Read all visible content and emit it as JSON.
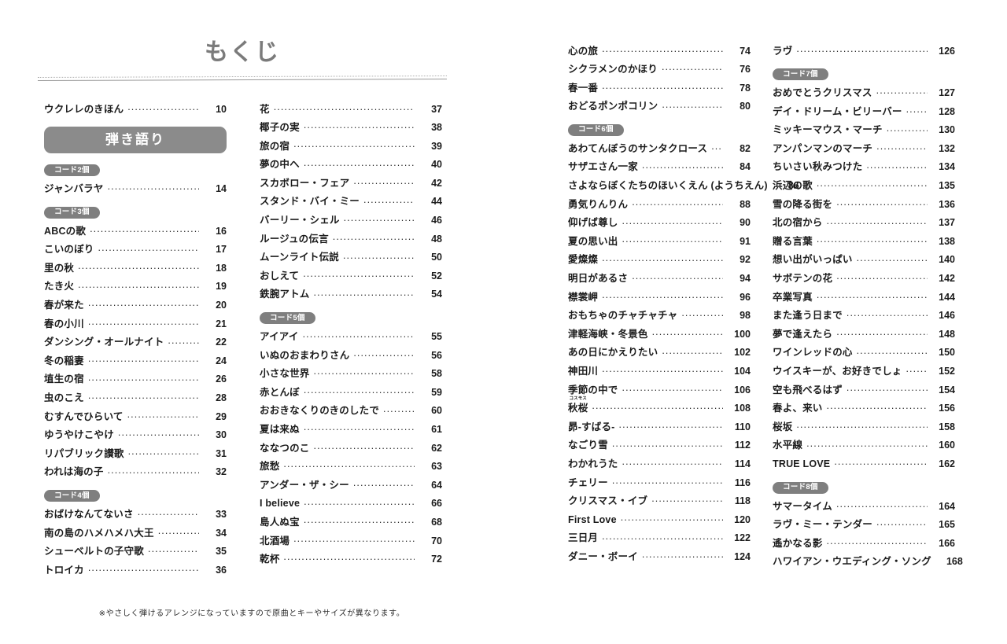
{
  "header": {
    "title": "もくじ"
  },
  "banner": {
    "label": "弾き語り"
  },
  "badges": {
    "chord2": "コード2個",
    "chord3": "コード3個",
    "chord4": "コード4個",
    "chord5": "コード5個",
    "chord6": "コード6個",
    "chord7": "コード7個",
    "chord8": "コード8個"
  },
  "columns": [
    {
      "id": "column-1",
      "blocks": [
        {
          "type": "entries",
          "entries": [
            {
              "title": "ウクレレのきほん",
              "page": "10"
            }
          ]
        },
        {
          "type": "banner",
          "label": "弾き語り"
        },
        {
          "type": "badge",
          "label": "コード2個"
        },
        {
          "type": "entries",
          "entries": [
            {
              "title": "ジャンバラヤ",
              "page": "14"
            }
          ]
        },
        {
          "type": "badge",
          "label": "コード3個"
        },
        {
          "type": "entries",
          "entries": [
            {
              "title": "ABCの歌",
              "page": "16"
            },
            {
              "title": "こいのぼり",
              "page": "17"
            },
            {
              "title": "里の秋",
              "page": "18"
            },
            {
              "title": "たき火",
              "page": "19"
            },
            {
              "title": "春が来た",
              "page": "20"
            },
            {
              "title": "春の小川",
              "page": "21"
            },
            {
              "title": "ダンシング・オールナイト",
              "page": "22"
            },
            {
              "title": "冬の稲妻",
              "page": "24"
            },
            {
              "title": "埴生の宿",
              "page": "26"
            },
            {
              "title": "虫のこえ",
              "page": "28"
            },
            {
              "title": "むすんでひらいて",
              "page": "29"
            },
            {
              "title": "ゆうやけこやけ",
              "page": "30"
            },
            {
              "title": "リパブリック讃歌",
              "page": "31"
            },
            {
              "title": "われは海の子",
              "page": "32"
            }
          ]
        },
        {
          "type": "badge",
          "label": "コード4個"
        },
        {
          "type": "entries",
          "entries": [
            {
              "title": "おばけなんてないさ",
              "page": "33"
            },
            {
              "title": "南の島のハメハメハ大王",
              "page": "34"
            },
            {
              "title": "シューベルトの子守歌",
              "page": "35"
            },
            {
              "title": "トロイカ",
              "page": "36"
            }
          ]
        }
      ]
    },
    {
      "id": "column-2",
      "blocks": [
        {
          "type": "entries",
          "entries": [
            {
              "title": "花",
              "page": "37"
            },
            {
              "title": "椰子の実",
              "page": "38"
            },
            {
              "title": "旅の宿",
              "page": "39"
            },
            {
              "title": "夢の中へ",
              "page": "40"
            },
            {
              "title": "スカボロー・フェア",
              "page": "42"
            },
            {
              "title": "スタンド・バイ・ミー",
              "page": "44"
            },
            {
              "title": "バーリー・シェル",
              "page": "46"
            },
            {
              "title": "ルージュの伝言",
              "page": "48"
            },
            {
              "title": "ムーンライト伝説",
              "page": "50"
            },
            {
              "title": "おしえて",
              "page": "52"
            },
            {
              "title": "鉄腕アトム",
              "page": "54"
            }
          ]
        },
        {
          "type": "badge",
          "label": "コード5個"
        },
        {
          "type": "entries",
          "entries": [
            {
              "title": "アイアイ",
              "page": "55"
            },
            {
              "title": "いぬのおまわりさん",
              "page": "56"
            },
            {
              "title": "小さな世界",
              "page": "58"
            },
            {
              "title": "赤とんぼ",
              "page": "59"
            },
            {
              "title": "おおきなくりのきのしたで",
              "page": "60"
            },
            {
              "title": "夏は来ぬ",
              "page": "61"
            },
            {
              "title": "ななつのこ",
              "page": "62"
            },
            {
              "title": "旅愁",
              "page": "63"
            },
            {
              "title": "アンダー・ザ・シー",
              "page": "64"
            },
            {
              "title": "I believe",
              "page": "66"
            },
            {
              "title": "島人ぬ宝",
              "page": "68"
            },
            {
              "title": "北酒場",
              "page": "70"
            },
            {
              "title": "乾杯",
              "page": "72"
            }
          ]
        }
      ]
    },
    {
      "id": "column-3",
      "blocks": [
        {
          "type": "entries",
          "entries": [
            {
              "title": "心の旅",
              "page": "74"
            },
            {
              "title": "シクラメンのかほり",
              "page": "76"
            },
            {
              "title": "春一番",
              "page": "78"
            },
            {
              "title": "おどるポンポコリン",
              "page": "80"
            }
          ]
        },
        {
          "type": "badge",
          "label": "コード6個"
        },
        {
          "type": "entries",
          "entries": [
            {
              "title": "あわてんぼうのサンタクロース",
              "page": "82"
            },
            {
              "title": "サザエさん一家",
              "page": "84"
            },
            {
              "title": "さよならぼくたちのほいくえん (ようちえん)",
              "page": "86"
            },
            {
              "title": "勇気りんりん",
              "page": "88"
            },
            {
              "title": "仰げば尊し",
              "page": "90"
            },
            {
              "title": "夏の思い出",
              "page": "91"
            },
            {
              "title": "愛燦燦",
              "page": "92"
            },
            {
              "title": "明日があるさ",
              "page": "94"
            },
            {
              "title": "襟裳岬",
              "page": "96"
            },
            {
              "title": "おもちゃのチャチャチャ",
              "page": "98"
            },
            {
              "title": "津軽海峡・冬景色",
              "page": "100"
            },
            {
              "title": "あの日にかえりたい",
              "page": "102"
            },
            {
              "title": "神田川",
              "page": "104"
            },
            {
              "title": "季節の中で",
              "page": "106"
            },
            {
              "title": "秋桜",
              "ruby": "コスモス",
              "page": "108"
            },
            {
              "title": "昴-すばる-",
              "page": "110"
            },
            {
              "title": "なごり雪",
              "page": "112"
            },
            {
              "title": "わかれうた",
              "page": "114"
            },
            {
              "title": "チェリー",
              "page": "116"
            },
            {
              "title": "クリスマス・イブ",
              "page": "118"
            },
            {
              "title": "First Love",
              "page": "120"
            },
            {
              "title": "三日月",
              "page": "122"
            },
            {
              "title": "ダニー・ボーイ",
              "page": "124"
            }
          ]
        }
      ]
    },
    {
      "id": "column-4",
      "blocks": [
        {
          "type": "entries",
          "entries": [
            {
              "title": "ラヴ",
              "page": "126"
            }
          ]
        },
        {
          "type": "badge",
          "label": "コード7個"
        },
        {
          "type": "entries",
          "entries": [
            {
              "title": "おめでとうクリスマス",
              "page": "127"
            },
            {
              "title": "デイ・ドリーム・ビリーバー",
              "page": "128"
            },
            {
              "title": "ミッキーマウス・マーチ",
              "page": "130"
            },
            {
              "title": "アンパンマンのマーチ",
              "page": "132"
            },
            {
              "title": "ちいさい秋みつけた",
              "page": "134"
            },
            {
              "title": "浜辺の歌",
              "page": "135"
            },
            {
              "title": "雪の降る街を",
              "page": "136"
            },
            {
              "title": "北の宿から",
              "page": "137"
            },
            {
              "title": "贈る言葉",
              "page": "138"
            },
            {
              "title": "想い出がいっぱい",
              "page": "140"
            },
            {
              "title": "サボテンの花",
              "page": "142"
            },
            {
              "title": "卒業写真",
              "page": "144"
            },
            {
              "title": "また逢う日まで",
              "page": "146"
            },
            {
              "title": "夢で逢えたら",
              "page": "148"
            },
            {
              "title": "ワインレッドの心",
              "page": "150"
            },
            {
              "title": "ウイスキーが、お好きでしょ",
              "page": "152"
            },
            {
              "title": "空も飛べるはず",
              "page": "154"
            },
            {
              "title": "春よ、来い",
              "page": "156"
            },
            {
              "title": "桜坂",
              "page": "158"
            },
            {
              "title": "水平線",
              "page": "160"
            },
            {
              "title": "TRUE LOVE",
              "page": "162"
            }
          ]
        },
        {
          "type": "badge",
          "label": "コード8個"
        },
        {
          "type": "entries",
          "entries": [
            {
              "title": "サマータイム",
              "page": "164"
            },
            {
              "title": "ラヴ・ミー・テンダー",
              "page": "165"
            },
            {
              "title": "遙かなる影",
              "page": "166"
            },
            {
              "title": "ハワイアン・ウエディング・ソング",
              "page": "168"
            }
          ]
        }
      ]
    }
  ],
  "footnote": {
    "text": "※やさしく弾けるアレンジになっていますので原曲とキーやサイズが異なります。"
  },
  "colors": {
    "banner_bg": "#8b8b8b",
    "badge_bg": "#7f7f7f",
    "title_gray": "#7b7b7b",
    "text": "#1b1b1b"
  }
}
